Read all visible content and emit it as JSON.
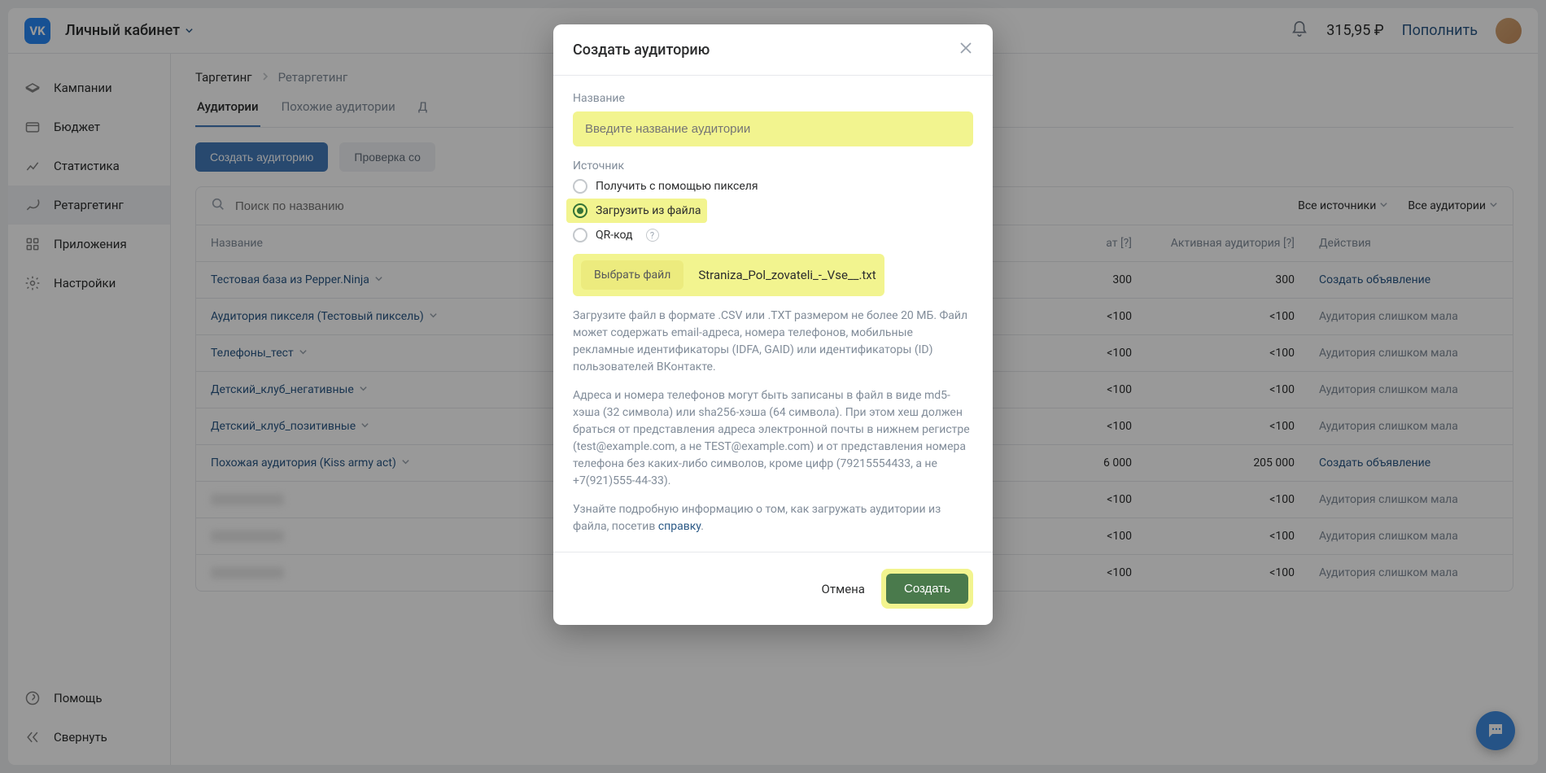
{
  "header": {
    "logo_text": "VK",
    "account_label": "Личный кабинет",
    "balance": "315,95 ₽",
    "topup": "Пополнить"
  },
  "sidebar": {
    "items": [
      {
        "label": "Кампании"
      },
      {
        "label": "Бюджет"
      },
      {
        "label": "Статистика"
      },
      {
        "label": "Ретаргетинг"
      },
      {
        "label": "Приложения"
      },
      {
        "label": "Настройки"
      }
    ],
    "bottom": [
      {
        "label": "Помощь"
      },
      {
        "label": "Свернуть"
      }
    ]
  },
  "breadcrumb": {
    "a": "Таргетинг",
    "b": "Ретаргетинг"
  },
  "tabs": [
    "Аудитории",
    "Похожие аудитории",
    "Д"
  ],
  "actions": {
    "create": "Создать аудиторию",
    "check": "Проверка со"
  },
  "table": {
    "search_placeholder": "Поиск по названию",
    "filter1": "Все источники",
    "filter2": "Все аудитории",
    "head": {
      "name": "Название",
      "cov": "ат [?]",
      "act": "Активная аудитория [?]",
      "action": "Действия"
    },
    "rows": [
      {
        "name": "Тестовая база из Pepper.Ninja",
        "cov": "300",
        "act": "300",
        "action": "Создать объявление",
        "ok": true
      },
      {
        "name": "Аудитория пикселя (Тестовый пиксель)",
        "cov": "<100",
        "act": "<100",
        "action": "Аудитория слишком мала",
        "ok": false
      },
      {
        "name": "Телефоны_тест",
        "cov": "<100",
        "act": "<100",
        "action": "Аудитория слишком мала",
        "ok": false
      },
      {
        "name": "Детский_клуб_негативные",
        "cov": "<100",
        "act": "<100",
        "action": "Аудитория слишком мала",
        "ok": false
      },
      {
        "name": "Детский_клуб_позитивные",
        "cov": "<100",
        "act": "<100",
        "action": "Аудитория слишком мала",
        "ok": false
      },
      {
        "name": "Похожая аудитория (Kiss army act)",
        "cov": "6 000",
        "act": "205 000",
        "action": "Создать объявление",
        "ok": true
      },
      {
        "name": "",
        "cov": "<100",
        "act": "<100",
        "action": "Аудитория слишком мала",
        "ok": false,
        "blur": true
      },
      {
        "name": "",
        "cov": "<100",
        "act": "<100",
        "action": "Аудитория слишком мала",
        "ok": false,
        "blur": true
      },
      {
        "name": "",
        "cov": "<100",
        "act": "<100",
        "action": "Аудитория слишком мала",
        "ok": false,
        "blur": true
      }
    ]
  },
  "modal": {
    "title": "Создать аудиторию",
    "name_label": "Название",
    "name_placeholder": "Введите название аудитории",
    "source_label": "Источник",
    "radios": [
      {
        "label": "Получить с помощью пикселя",
        "sel": false,
        "hl": false
      },
      {
        "label": "Загрузить из файла",
        "sel": true,
        "hl": true
      },
      {
        "label": "QR-код",
        "sel": false,
        "hl": false,
        "help": true
      }
    ],
    "file_btn": "Выбрать файл",
    "file_name": "Straniza_Pol_zovateli_-_Vse__.txt",
    "desc1": "Загрузите файл в формате .CSV или .TXT размером не более 20 МБ. Файл может содержать email-адреса, номера телефонов, мобильные рекламные идентификаторы (IDFA, GAID) или идентификаторы (ID) пользователей ВКонтакте.",
    "desc2": "Адреса и номера телефонов могут быть записаны в файл в виде md5-хэша (32 символа) или sha256-хэша (64 символа). При этом хеш должен браться от представления адреса электронной почты в нижнем регистре (test@example.com, а не TEST@example.com) и от представления номера телефона без каких-либо символов, кроме цифр (79215554433, а не +7(921)555-44-33).",
    "desc3_a": "Узнайте подробную информацию о том, как загружать аудитории из файла, посетив ",
    "desc3_link": "справку",
    "desc3_b": ".",
    "cancel": "Отмена",
    "create": "Создать"
  }
}
